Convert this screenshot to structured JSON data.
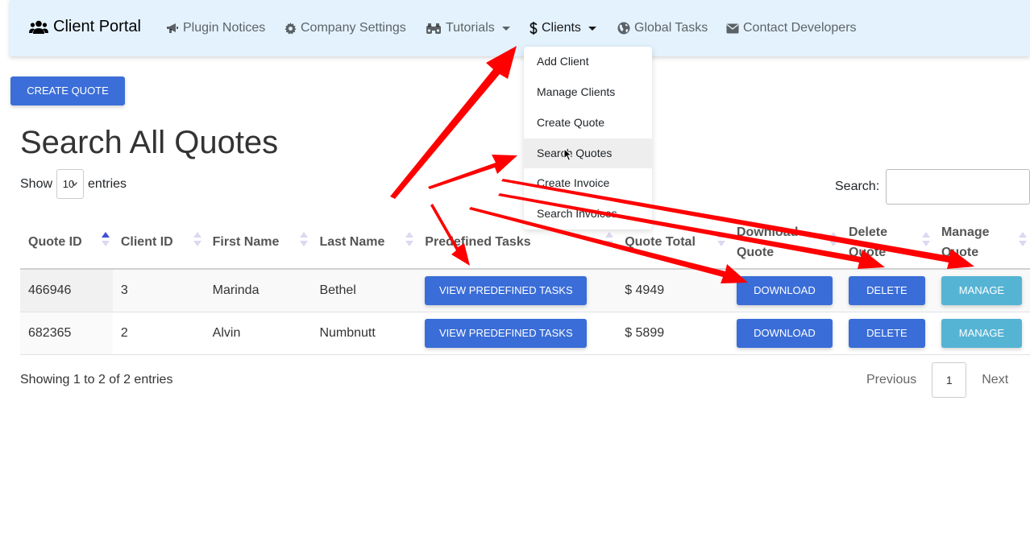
{
  "navbar": {
    "brand": "Client Portal",
    "items": [
      {
        "label": "Plugin Notices",
        "icon": "bullhorn-icon"
      },
      {
        "label": "Company Settings",
        "icon": "gear-icon"
      },
      {
        "label": "Tutorials",
        "icon": "binoculars-icon"
      },
      {
        "label": "Clients",
        "icon": "dollar-icon"
      },
      {
        "label": "Global Tasks",
        "icon": "globe-icon"
      },
      {
        "label": "Contact Developers",
        "icon": "envelope-icon"
      }
    ]
  },
  "dropdown": {
    "items": [
      "Add Client",
      "Manage Clients",
      "Create Quote",
      "Search Quotes",
      "Create Invoice",
      "Search Invoices"
    ],
    "hovered": "Search Quotes"
  },
  "create_button": "CREATE QUOTE",
  "page_title": "Search All Quotes",
  "length_control": {
    "show": "Show",
    "value": "10",
    "entries": "entries"
  },
  "search_label": "Search:",
  "table": {
    "headers": [
      "Quote ID",
      "Client ID",
      "First Name",
      "Last Name",
      "Predefined Tasks",
      "Quote Total",
      "Download Quote",
      "Delete Quote",
      "Manage Quote"
    ],
    "rows": [
      {
        "quote_id": "466946",
        "client_id": "3",
        "first_name": "Marinda",
        "last_name": "Bethel",
        "tasks_btn": "VIEW PREDEFINED TASKS",
        "total": "$ 4949",
        "download_btn": "DOWNLOAD",
        "delete_btn": "DELETE",
        "manage_btn": "MANAGE"
      },
      {
        "quote_id": "682365",
        "client_id": "2",
        "first_name": "Alvin",
        "last_name": "Numbnutt",
        "tasks_btn": "VIEW PREDEFINED TASKS",
        "total": "$ 5899",
        "download_btn": "DOWNLOAD",
        "delete_btn": "DELETE",
        "manage_btn": "MANAGE"
      }
    ]
  },
  "info": "Showing 1 to 2 of 2 entries",
  "pagination": {
    "previous": "Previous",
    "page": "1",
    "next": "Next"
  },
  "colors": {
    "navbar_bg": "#e3f2fd",
    "primary_button": "#3a6dd7",
    "info_button": "#55b4d4",
    "annotation_arrow": "#ff0000"
  }
}
